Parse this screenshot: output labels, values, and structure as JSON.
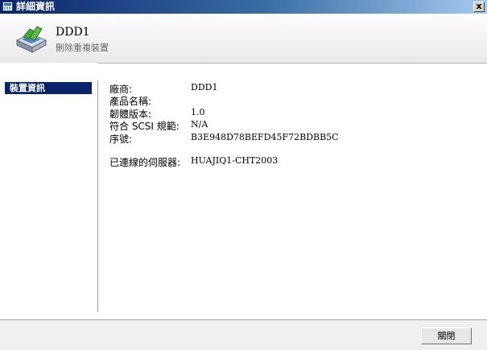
{
  "window": {
    "title": "詳細資訊",
    "close_glyph": "x"
  },
  "header": {
    "device_name": "DDD1",
    "device_type": "刪除重複裝置"
  },
  "sidebar": {
    "items": [
      {
        "label": "裝置資訊",
        "selected": true
      }
    ]
  },
  "details": {
    "vendor": {
      "label": "廠商:",
      "value": "DDD1"
    },
    "product": {
      "label": "產品名稱:",
      "value": ""
    },
    "firmware": {
      "label": "韌體版本:",
      "value": "1.0"
    },
    "scsi": {
      "label": "符合 SCSI 規範:",
      "value": "N/A"
    },
    "serial": {
      "label": "序號:",
      "value": "B3E948D78BEFD45F72BDBB5C"
    },
    "connected": {
      "label": "已連線的伺服器:",
      "value": "HUAJIQ1-CHT2003"
    }
  },
  "footer": {
    "close_label": "關閉"
  },
  "colors": {
    "title_bar": "#0a246a",
    "selection": "#0a246a",
    "icon_green": "#3c9a2e",
    "icon_blue": "#3d72b8"
  },
  "icons": {
    "title": "grid-window-icon",
    "device": "deduplication-drive-icon"
  }
}
